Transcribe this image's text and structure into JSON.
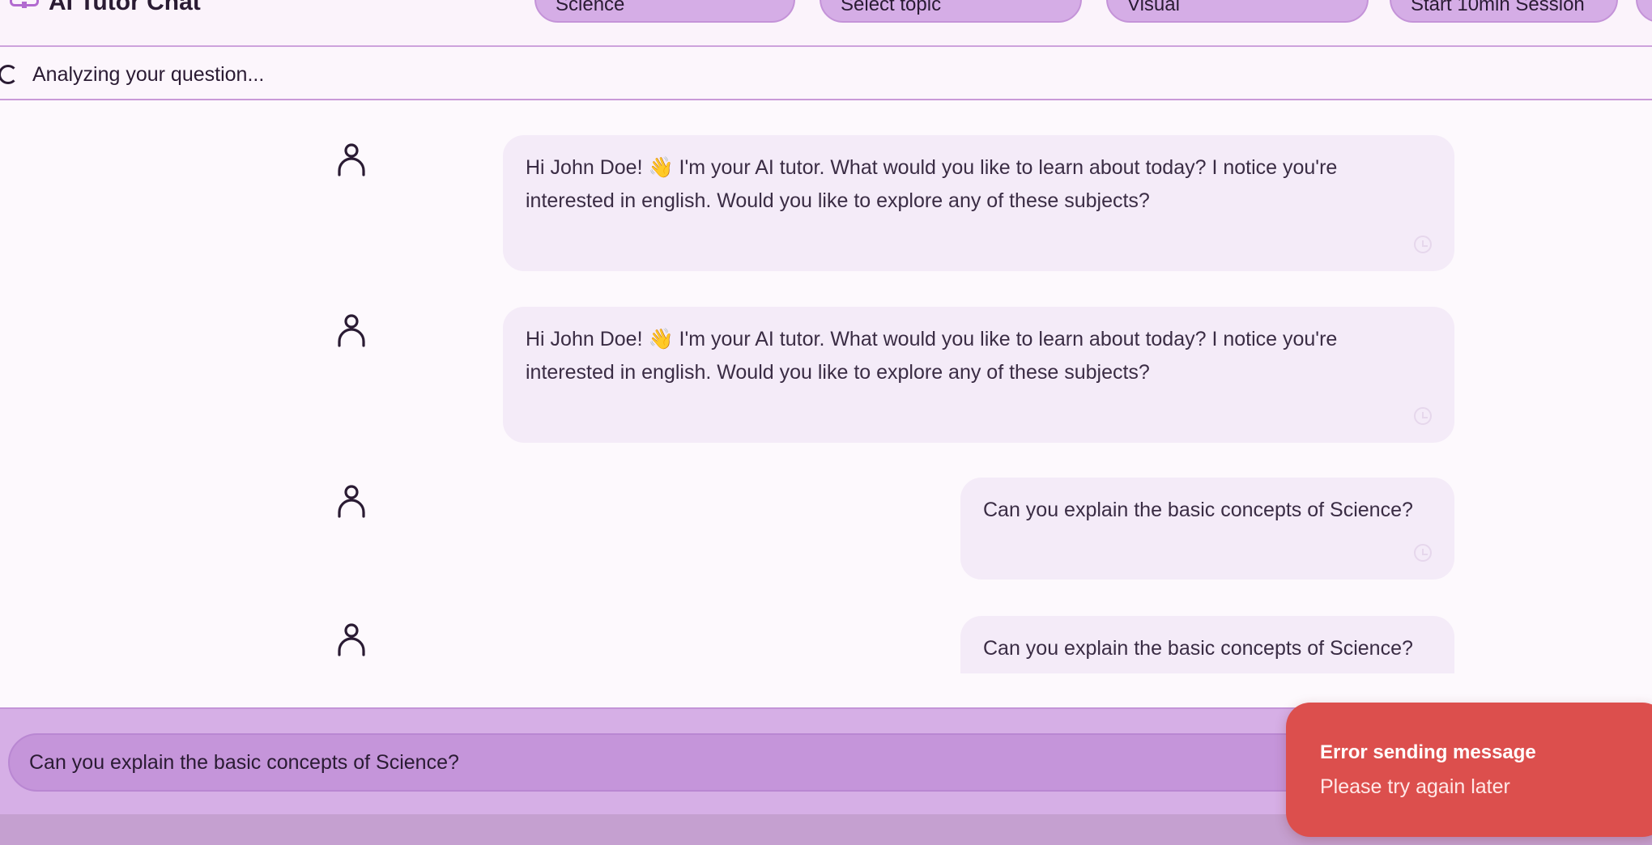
{
  "header": {
    "title": "AI Tutor Chat",
    "subject_select": "Science",
    "topic_select": "Select topic",
    "mode_select": "Visual",
    "session_button": "Start 10min Session"
  },
  "status": {
    "text": "Analyzing your question..."
  },
  "messages": [
    {
      "text": "Hi John Doe! 👋 I'm your AI tutor. What would you like to learn about today? I notice you're interested in english. Would you like to explore any of these subjects?"
    },
    {
      "text": "Hi John Doe! 👋 I'm your AI tutor. What would you like to learn about today? I notice you're interested in english. Would you like to explore any of these subjects?"
    },
    {
      "text": "Can you explain the basic concepts of Science?"
    },
    {
      "text": "Can you explain the basic concepts of Science?"
    }
  ],
  "composer": {
    "value": "Can you explain the basic concepts of Science?"
  },
  "toast": {
    "title": "Error sending message",
    "description": "Please try again later"
  },
  "colors": {
    "accent": "#d5ade6",
    "error": "#dc4f4d",
    "bubble": "#f4ebf8"
  }
}
